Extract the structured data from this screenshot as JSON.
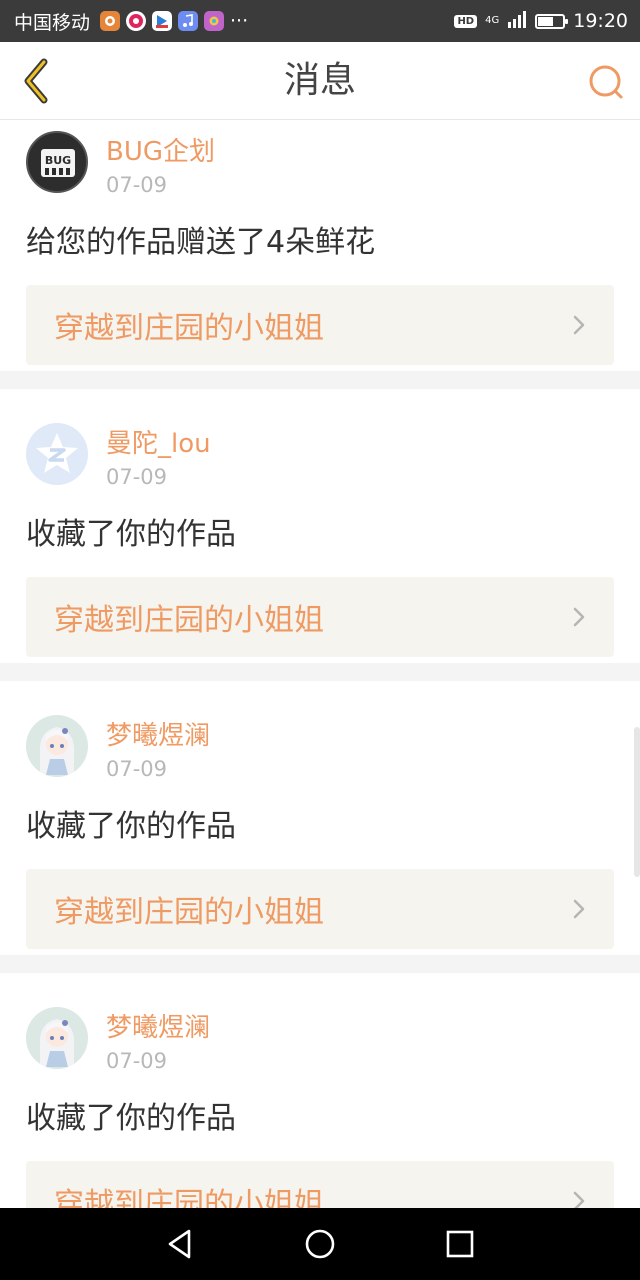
{
  "status_bar": {
    "carrier": "中国移动",
    "more": "···",
    "hd": "HD",
    "network": "4G",
    "time": "19:20",
    "battery_level": 0.6,
    "icons": [
      "squirrel-app-icon",
      "red-circle-app-icon",
      "video-app-icon",
      "music-app-icon",
      "camera-app-icon"
    ]
  },
  "header": {
    "title": "消息",
    "back_icon": "chevron-left-icon",
    "search_icon": "search-icon",
    "accent_color": "#ef9a63"
  },
  "messages": [
    {
      "username": "BUG企划",
      "time": "07-09",
      "text": "给您的作品赠送了4朵鲜花",
      "work_title": "穿越到庄园的小姐姐",
      "avatar": "bug-logo-avatar"
    },
    {
      "username": "曼陀_lou",
      "time": "07-09",
      "text": "收藏了你的作品",
      "work_title": "穿越到庄园的小姐姐",
      "avatar": "qq-default-avatar"
    },
    {
      "username": "梦曦煜澜",
      "time": "07-09",
      "text": "收藏了你的作品",
      "work_title": "穿越到庄园的小姐姐",
      "avatar": "anime-girl-avatar"
    },
    {
      "username": "梦曦煜澜",
      "time": "07-09",
      "text": "收藏了你的作品",
      "work_title": "穿越到庄园的小姐姐",
      "avatar": "anime-girl-avatar"
    }
  ],
  "nav_bar": {
    "back": "back-triangle-icon",
    "home": "home-circle-icon",
    "recents": "recents-square-icon"
  }
}
